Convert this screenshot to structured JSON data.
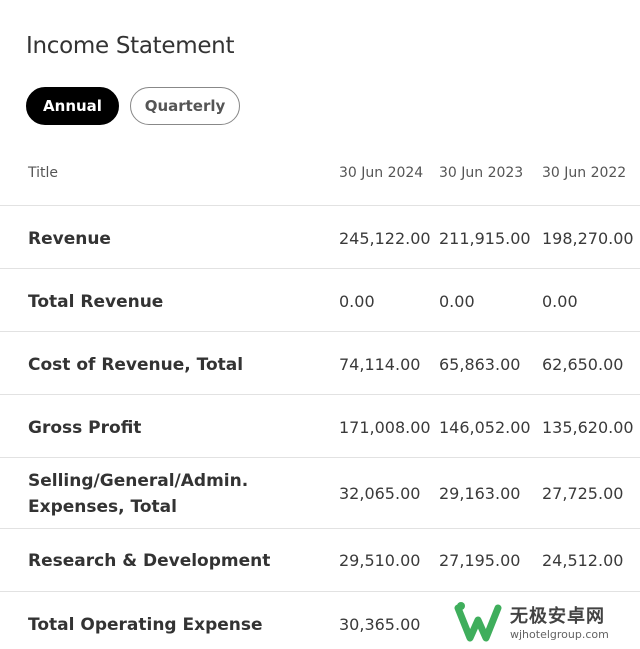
{
  "page": {
    "title": "Income Statement"
  },
  "toggle": {
    "annual": "Annual",
    "quarterly": "Quarterly"
  },
  "table": {
    "headers": [
      "Title",
      "30 Jun 2024",
      "30 Jun 2023",
      "30 Jun 2022"
    ],
    "rows": [
      {
        "label": "Revenue",
        "values": [
          "245,122.00",
          "211,915.00",
          "198,270.00"
        ]
      },
      {
        "label": "Total Revenue",
        "values": [
          "0.00",
          "0.00",
          "0.00"
        ]
      },
      {
        "label": "Cost of Revenue, Total",
        "values": [
          "74,114.00",
          "65,863.00",
          "62,650.00"
        ]
      },
      {
        "label": "Gross Profit",
        "values": [
          "171,008.00",
          "146,052.00",
          "135,620.00"
        ]
      },
      {
        "label_line1": "Selling/General/Admin.",
        "label_line2": "Expenses, Total",
        "values": [
          "32,065.00",
          "29,163.00",
          "27,725.00"
        ]
      },
      {
        "label": "Research & Development",
        "values": [
          "29,510.00",
          "27,195.00",
          "24,512.00"
        ]
      },
      {
        "label": "Total Operating Expense",
        "values": [
          "30,365.00"
        ]
      }
    ]
  },
  "watermark": {
    "name": "无极安卓网",
    "url": "wjhotelgroup.com",
    "brand_color": "#2fa84f"
  }
}
